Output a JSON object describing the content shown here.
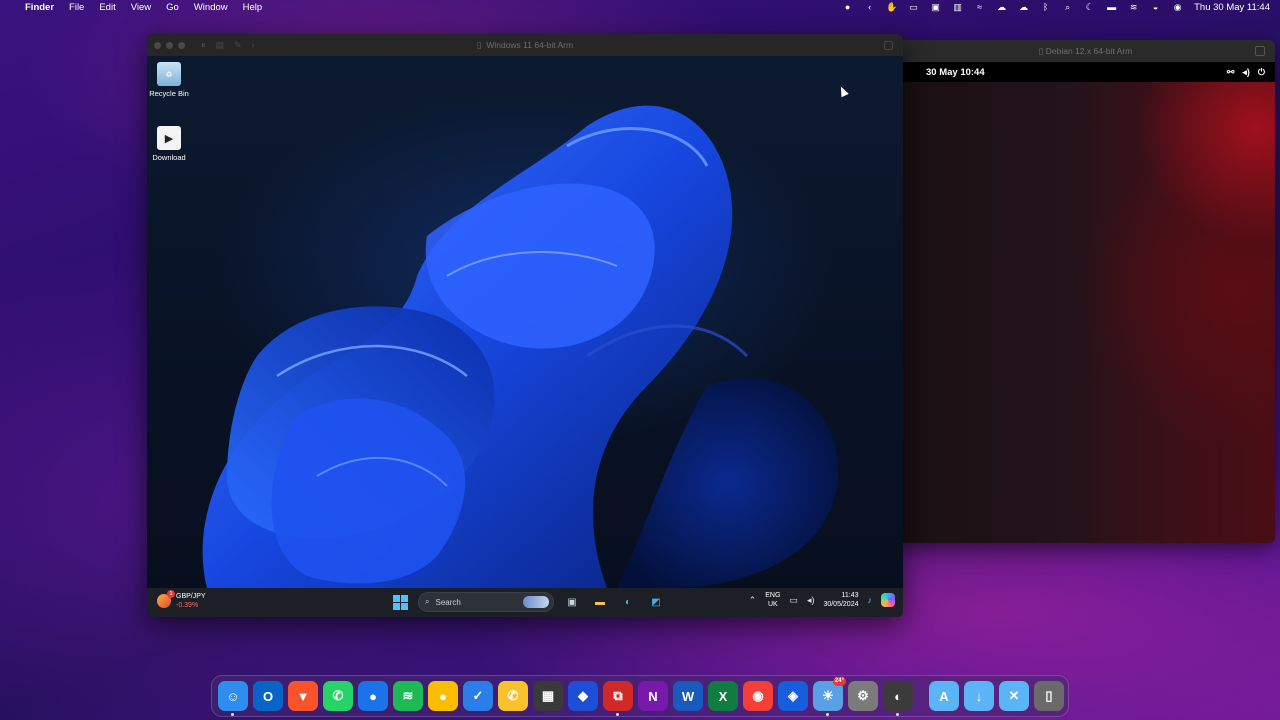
{
  "menubar": {
    "apple_glyph": "",
    "app_name": "Finder",
    "menus": [
      "File",
      "Edit",
      "View",
      "Go",
      "Window",
      "Help"
    ],
    "status_icons": [
      "record-icon",
      "chevron-left-icon",
      "hand-icon",
      "display-icon",
      "screen-icon",
      "parallels-icon",
      "wind-icon",
      "cloud-icon",
      "cloud-icon",
      "bluetooth-icon",
      "search-icon",
      "moon-icon",
      "battery-icon",
      "wifi-icon",
      "control-center-icon",
      "siri-icon"
    ],
    "clock": "Thu 30 May  11:44"
  },
  "windows_vm": {
    "title": "Windows 11 64-bit Arm",
    "desktop_icons": [
      {
        "label": "Recycle Bin",
        "icon": "recycle-bin-icon"
      },
      {
        "label": "Download",
        "icon": "download-icon"
      }
    ],
    "taskbar": {
      "widget_title": "GBP/JPY",
      "widget_change": "-0.39%",
      "widget_badge": "1",
      "search_placeholder": "Search",
      "lang_top": "ENG",
      "lang_bottom": "UK",
      "time": "11:43",
      "date": "30/05/2024"
    }
  },
  "debian_vm": {
    "title": "Debian 12.x 64-bit Arm",
    "clock": "30 May  10:44"
  },
  "dock": {
    "apps": [
      {
        "name": "Finder",
        "glyph": "☺",
        "color": "#2f8df0",
        "running": true
      },
      {
        "name": "Outlook",
        "glyph": "O",
        "color": "#0a64c8",
        "running": false
      },
      {
        "name": "Brave",
        "glyph": "▼",
        "color": "#fb542b",
        "running": false
      },
      {
        "name": "WhatsApp",
        "glyph": "✆",
        "color": "#25d366",
        "running": false
      },
      {
        "name": "Messages",
        "glyph": "●",
        "color": "#1a73e8",
        "running": false
      },
      {
        "name": "Spotify",
        "glyph": "≋",
        "color": "#1db954",
        "running": false
      },
      {
        "name": "Keep",
        "glyph": "●",
        "color": "#fbbc04",
        "running": false
      },
      {
        "name": "Tasks",
        "glyph": "✓",
        "color": "#2b7de9",
        "running": false
      },
      {
        "name": "Phone",
        "glyph": "✆",
        "color": "#f7c22b",
        "running": false
      },
      {
        "name": "Calculator",
        "glyph": "▦",
        "color": "#3a3a3a",
        "running": false
      },
      {
        "name": "VirtualBox",
        "glyph": "◆",
        "color": "#1d4ed8",
        "running": false
      },
      {
        "name": "Parallels",
        "glyph": "⧉",
        "color": "#d22828",
        "running": true
      },
      {
        "name": "OneNote",
        "glyph": "N",
        "color": "#7719aa",
        "running": false
      },
      {
        "name": "Word",
        "glyph": "W",
        "color": "#185abd",
        "running": false
      },
      {
        "name": "Excel",
        "glyph": "X",
        "color": "#107c41",
        "running": false
      },
      {
        "name": "Pocket Casts",
        "glyph": "◉",
        "color": "#f43e37",
        "running": false
      },
      {
        "name": "Bitwarden",
        "glyph": "◈",
        "color": "#175ddc",
        "running": false
      },
      {
        "name": "Weather",
        "glyph": "☀",
        "color": "#5aa0e6",
        "running": true,
        "badge": "24°"
      },
      {
        "name": "System Settings",
        "glyph": "⚙",
        "color": "#7b7b7b",
        "running": false
      },
      {
        "name": "Screen Sharing",
        "glyph": "◐",
        "color": "#3b3b3b",
        "running": true
      }
    ],
    "folders": [
      {
        "name": "Applications",
        "glyph": "A",
        "color": "#5ab4f5"
      },
      {
        "name": "Downloads",
        "glyph": "↓",
        "color": "#5ab4f5"
      },
      {
        "name": "Utilities",
        "glyph": "✕",
        "color": "#5ab4f5"
      },
      {
        "name": "Trash",
        "glyph": "▯",
        "color": "#6a6a6a"
      }
    ]
  }
}
